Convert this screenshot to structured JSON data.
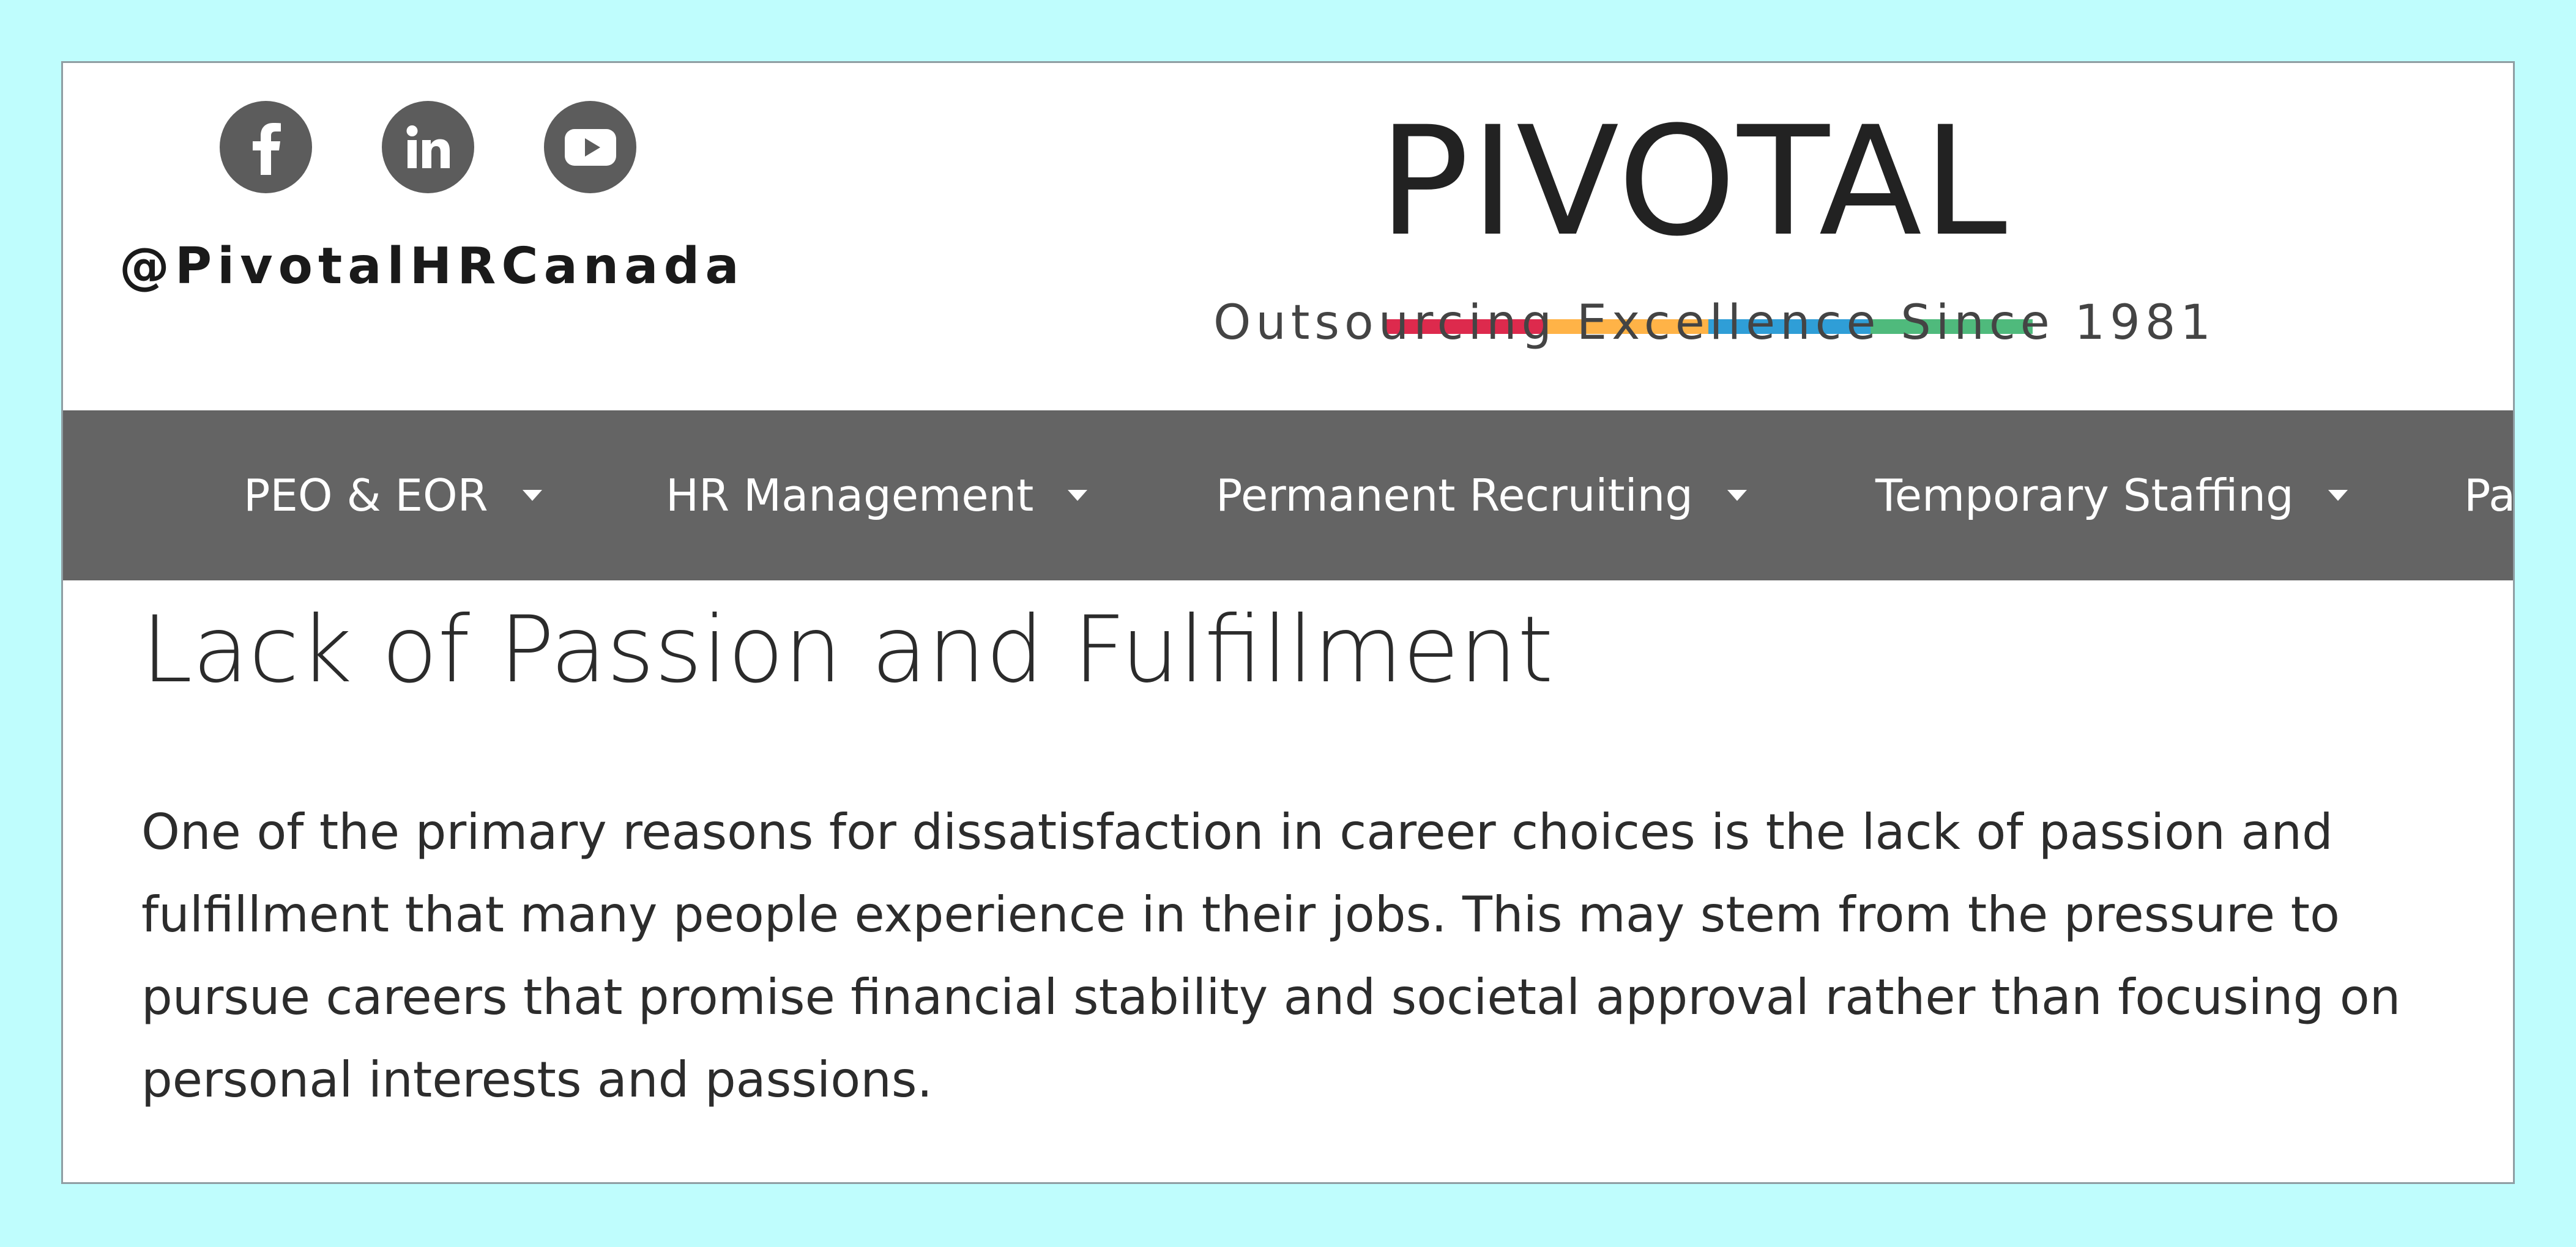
{
  "header": {
    "social_icons": [
      {
        "name": "facebook-icon",
        "glyph": "f"
      },
      {
        "name": "linkedin-icon",
        "glyph": "in"
      },
      {
        "name": "youtube-icon",
        "glyph": "play"
      }
    ],
    "handle": "@PivotalHRCanada",
    "logo": {
      "word": "PIVOTAL",
      "bar_colors": [
        "#dd2a4d",
        "#ffb347",
        "#2f9ed7",
        "#4fba7c"
      ],
      "tagline": "Outsourcing Excellence Since 1981"
    }
  },
  "nav": {
    "items": [
      {
        "label": "PEO & EOR"
      },
      {
        "label": "HR Management"
      },
      {
        "label": "Permanent Recruiting"
      },
      {
        "label": "Temporary Staffing"
      },
      {
        "label": "Pa"
      }
    ]
  },
  "content": {
    "heading": "Lack of Passion and Fulfillment",
    "paragraph": "One of the primary reasons for dissatisfaction in career choices is the lack of passion and fulfillment that many people experience in their jobs. This may stem from the pressure to pursue careers that promise financial stability and societal approval rather than focusing on personal interests and passions."
  },
  "colors": {
    "page_background": "#bffdfd",
    "nav_background": "#646464",
    "icon_circle": "#5c5c5c"
  }
}
